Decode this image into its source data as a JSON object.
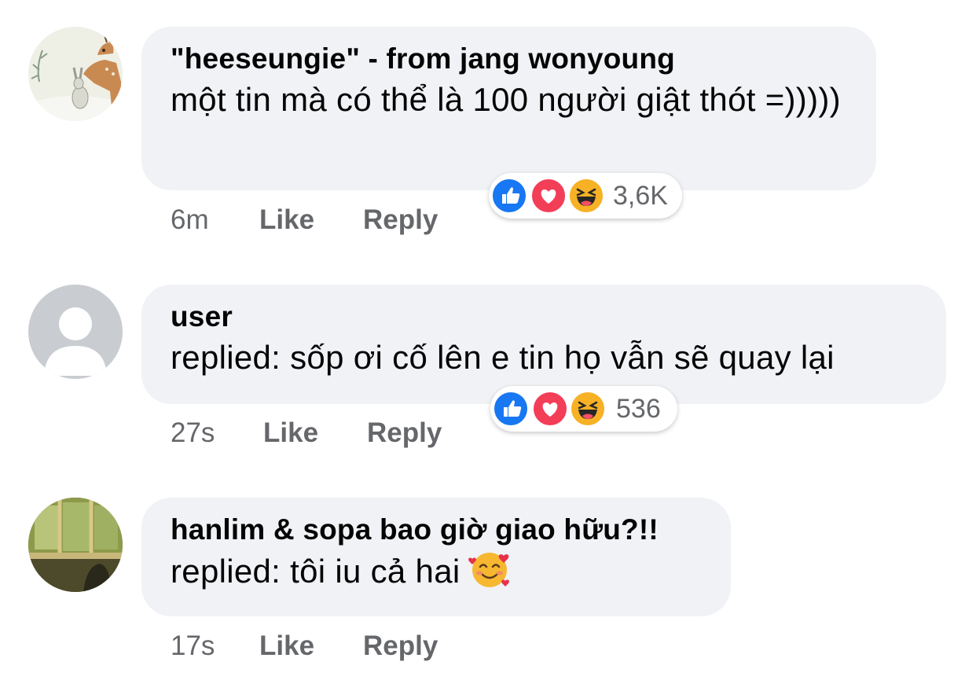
{
  "comments": [
    {
      "author": "\"heeseungie\" - from jang wonyoung",
      "text": "một tin mà có thể là 100 người giật thót =)))))",
      "time": "6m",
      "like_label": "Like",
      "reply_label": "Reply",
      "reaction_count": "3,6K",
      "reactions": [
        "like-icon",
        "love-icon",
        "haha-icon"
      ],
      "avatar": "deer-and-rabbit-illustration"
    },
    {
      "author": "user",
      "text": "replied: sốp ơi cố lên e tin họ vẫn sẽ quay lại",
      "time": "27s",
      "like_label": "Like",
      "reply_label": "Reply",
      "reaction_count": "536",
      "reactions": [
        "like-icon",
        "love-icon",
        "haha-icon"
      ],
      "avatar": "default-user-avatar"
    },
    {
      "author": "hanlim & sopa bao giờ giao hữu?!!",
      "text": "replied: tôi iu cả hai",
      "text_emoji": "smiling-face-with-hearts-icon",
      "time": "17s",
      "like_label": "Like",
      "reply_label": "Reply",
      "avatar": "room-window-photo"
    }
  ],
  "colors": {
    "bubble": "#f0f2f5",
    "secondary_text": "#65676b",
    "like_blue": "#1877f2",
    "love_red": "#f33e58",
    "haha_yellow": "#f7b125"
  }
}
